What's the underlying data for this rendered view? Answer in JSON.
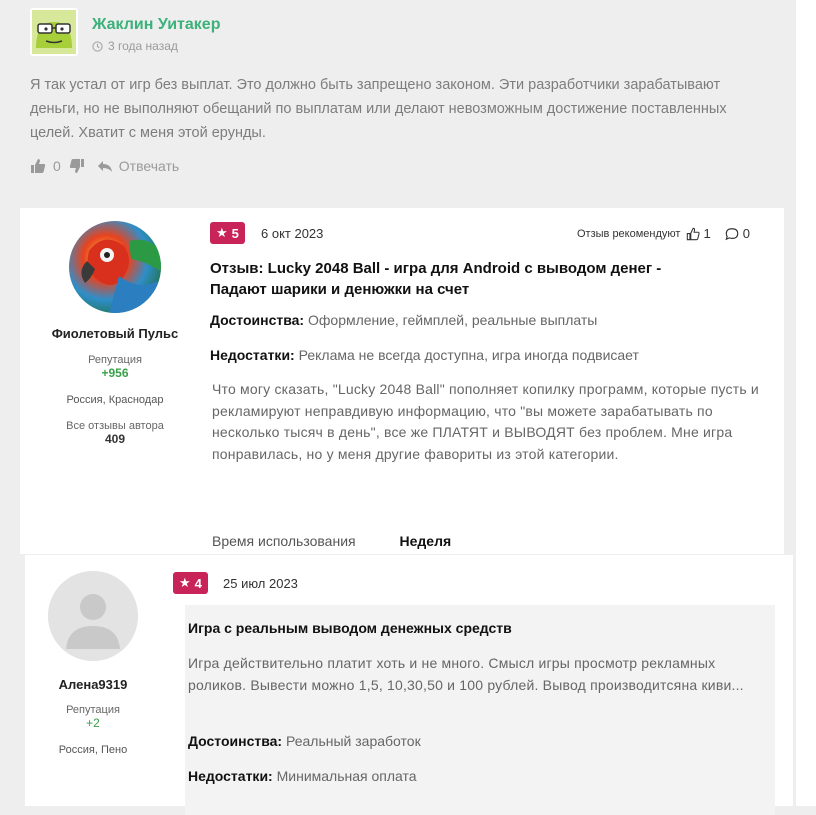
{
  "comment": {
    "author": "Жаклин Уитакер",
    "time": "3 года назад",
    "text": "Я так устал от игр без выплат. Это должно быть запрещено законом. Эти разработчики зарабатывают деньги, но не выполняют обещаний по выплатам или делают невозможным достижение поставленных целей. Хватит с меня этой ерунды.",
    "likes": "0",
    "reply_label": "Отвечать"
  },
  "review1": {
    "author": "Фиолетовый Пульс",
    "reputation_label": "Репутация",
    "reputation": "+956",
    "city": "Россия, Краснодар",
    "all_reviews_label": "Все отзывы автора",
    "reviews_count": "409",
    "rating": "5",
    "date": "6 окт 2023",
    "recommend_label": "Отзыв рекомендуют",
    "recommend_count": "1",
    "comments_count": "0",
    "title_line1": "Отзыв: Lucky 2048 Ball - игра для Android с выводом денег -",
    "title_line2": "Падают шарики и денюжки на счет",
    "pros_label": "Достоинства:",
    "pros": "Оформление, геймплей, реальные выплаты",
    "cons_label": "Недостатки:",
    "cons": "Реклама не всегда доступна, игра иногда подвисает",
    "body": "Что могу сказать, \"Lucky 2048 Ball\" пополняет копилку программ, которые пусть и рекламируют неправдивую информацию, что \"вы можете зарабатывать по несколько тысяч в день\", все же ПЛАТЯТ и ВЫВОДЯТ без проблем. Мне игра понравилась, но у меня другие фавориты из этой категории.",
    "usage_label": "Время использования",
    "usage_value": "Неделя"
  },
  "review2": {
    "author": "Алена9319",
    "reputation_label": "Репутация",
    "reputation": "+2",
    "city": "Россия, Пено",
    "rating": "4",
    "date": "25 июл 2023",
    "title": "Игра с реальным выводом денежных средств",
    "body": "Игра действительно платит хоть и не много. Смысл игры просмотр рекламных роликов. Вывести можно 1,5, 10,30,50 и 100 рублей. Вывод производитсяна киви...",
    "pros_label": "Достоинства:",
    "pros": "Реальный заработок",
    "cons_label": "Недостатки:",
    "cons": "Минимальная оплата"
  },
  "colors": {
    "accent_green": "#3cb17a",
    "badge": "#c9245a",
    "reputation": "#3aa04a"
  }
}
